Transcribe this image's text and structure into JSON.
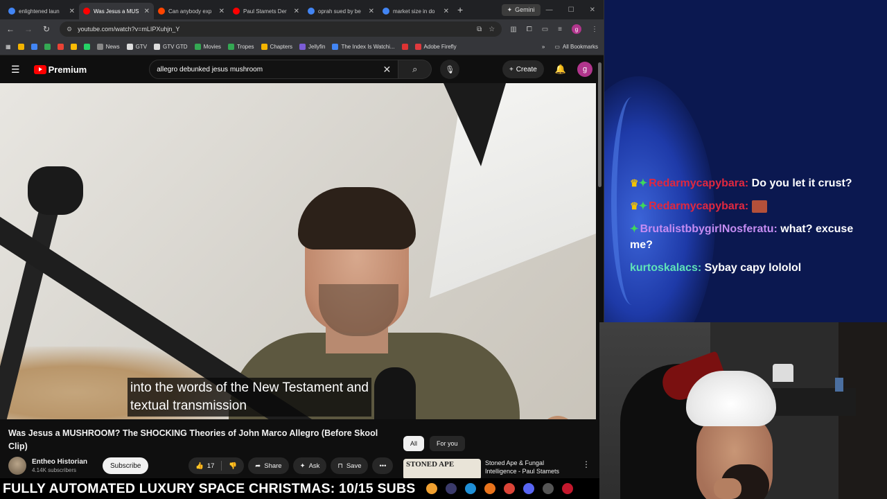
{
  "browser": {
    "tabs": [
      {
        "label": "enlightened laun",
        "icon_color": "#4285f4",
        "active": false
      },
      {
        "label": "Was Jesus a MUS",
        "icon_color": "#ff0000",
        "active": true
      },
      {
        "label": "Can anybody exp",
        "icon_color": "#ff4500",
        "active": false
      },
      {
        "label": "Paul Stamets Der",
        "icon_color": "#ff0000",
        "active": false
      },
      {
        "label": "oprah sued by be",
        "icon_color": "#4285f4",
        "active": false
      },
      {
        "label": "market size in do",
        "icon_color": "#4285f4",
        "active": false
      }
    ],
    "tab_close": "✕",
    "new_tab": "+",
    "gemini_label": "Gemini",
    "window_controls": [
      "—",
      "☐",
      "✕"
    ],
    "url": "youtube.com/watch?v=mLIPXuhjn_Y",
    "bookmarks": [
      {
        "label": "",
        "icon_color": "#f4b400"
      },
      {
        "label": "",
        "icon_color": "#4285f4"
      },
      {
        "label": "",
        "icon_color": "#34a853"
      },
      {
        "label": "",
        "icon_color": "#ea4335"
      },
      {
        "label": "",
        "icon_color": "#fbbc05"
      },
      {
        "label": "",
        "icon_color": "#25d366"
      },
      {
        "label": "News",
        "icon_color": "#888888"
      },
      {
        "label": "GTV",
        "icon_color": "#dddddd"
      },
      {
        "label": "GTV GTD",
        "icon_color": "#dddddd"
      },
      {
        "label": "Movies",
        "icon_color": "#34a853"
      },
      {
        "label": "Tropes",
        "icon_color": "#34a853"
      },
      {
        "label": "Chapters",
        "icon_color": "#f4b400"
      },
      {
        "label": "Jellyfin",
        "icon_color": "#7b5cd6"
      },
      {
        "label": "The Index Is Watchi...",
        "icon_color": "#4285f4"
      },
      {
        "label": "",
        "icon_color": "#d33"
      },
      {
        "label": "Adobe Firefly",
        "icon_color": "#e03a3e"
      }
    ],
    "all_bookmarks": "All Bookmarks"
  },
  "youtube": {
    "logo_text": "Premium",
    "search_value": "allegro debunked jesus mushroom",
    "create_label": "Create",
    "avatar_letter": "g",
    "subtitle_line1": "into the words of the New Testament and",
    "subtitle_line2": "textual transmission",
    "video_title": "Was Jesus a MUSHROOM? The SHOCKING Theories of John Marco Allegro (Before Skool Clip)",
    "channel_name": "Entheo Historian",
    "subscribers": "4.14K subscribers",
    "subscribe_label": "Subscribe",
    "like_count": "17",
    "share_label": "Share",
    "ask_label": "Ask",
    "save_label": "Save",
    "chips": [
      "All",
      "For you"
    ],
    "rec_thumb_text": "STONED APE",
    "rec_title": "Stoned Ape & Fungal Intelligence - Paul Stamets"
  },
  "chat": [
    {
      "badges": "crown+gem",
      "user": "Redarmycapybara:",
      "user_color": "#e0283f",
      "text": "Do you let it crust?"
    },
    {
      "badges": "crown+gem",
      "user": "Redarmycapybara:",
      "user_color": "#e0283f",
      "text": "",
      "emote": true
    },
    {
      "badges": "gem",
      "user": "BrutalistbbygirlNosferatu:",
      "user_color": "#c58cf2",
      "text": "what? excuse me?"
    },
    {
      "badges": "",
      "user": "kurtoskalacs:",
      "user_color": "#5fe3b8",
      "text": "Sybay capy lololol"
    }
  ],
  "banner": {
    "text": "FULLY AUTOMATED LUXURY SPACE CHRISTMAS: 10/15 SUBS"
  }
}
